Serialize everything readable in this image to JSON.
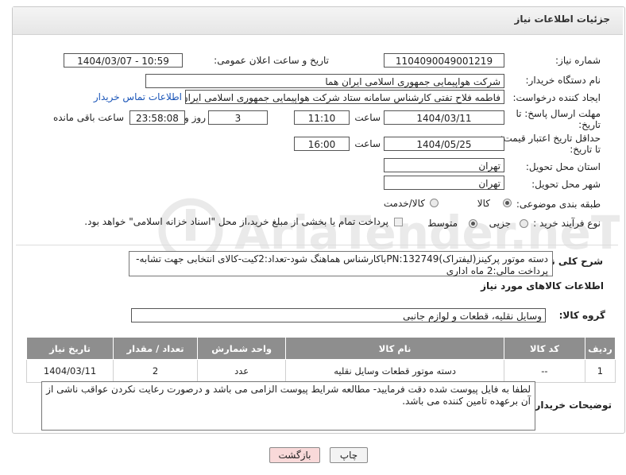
{
  "header": {
    "title": "جزئیات اطلاعات نیاز"
  },
  "fields": {
    "need_number_label": "شماره نیاز:",
    "need_number": "1104090049001219",
    "announce_label": "تاریخ و ساعت اعلان عمومی:",
    "announce_value": "1404/03/07 - 10:59",
    "buyer_org_label": "نام دستگاه خریدار:",
    "buyer_org": "شرکت هواپیمایی جمهوری اسلامی ایران هما",
    "requester_label": "ایجاد کننده درخواست:",
    "requester": "فاطمه فلاح تفتی کارشناس سامانه ستاد شرکت هواپیمایی جمهوری اسلامی ایران هما",
    "contact_link": "اطلاعات تماس خریدار",
    "deadline_label_1": "مهلت ارسال پاسخ: تا",
    "deadline_label_2": "تاریخ:",
    "deadline_date": "1404/03/11",
    "time_label": "ساعت",
    "deadline_time": "11:10",
    "days_value": "3",
    "days_label": "روز و",
    "remaining_value": "23:58:08",
    "remaining_label": "ساعت باقی مانده",
    "validity_label_1": "حداقل تاریخ اعتبار قیمت:",
    "validity_label_2": "تا تاریخ:",
    "validity_date": "1404/05/25",
    "validity_time_label": "ساعت",
    "validity_time": "16:00",
    "province_label": "استان محل تحویل:",
    "province": "تهران",
    "city_label": "شهر محل تحویل:",
    "city": "تهران",
    "category_label": "طبقه بندی موضوعی:",
    "category_options": [
      "کالا",
      "کالا/خدمت"
    ],
    "process_label": "نوع فرآیند خرید :",
    "process_options": [
      "جزیی",
      "متوسط"
    ],
    "payment_note": "پرداخت تمام یا بخشی از مبلغ خرید،از محل \"اسناد خزانه اسلامی\" خواهد بود."
  },
  "description": {
    "label": "شرح کلی نیاز:",
    "line1": "دسته موتور پرکینز(لیفتراک)PN:132749باکارشناس هماهنگ شود-تعداد:2کیت-کالای انتخابی جهت تشابه-",
    "line2": "پرداخت مالی:2 ماه اداری"
  },
  "goods": {
    "section_title": "اطلاعات کالاهای مورد نیاز",
    "group_label": "گروه کالا:",
    "group_value": "وسایل نقلیه، قطعات و لوازم جانبی",
    "columns": [
      "ردیف",
      "کد کالا",
      "نام کالا",
      "واحد شمارش",
      "تعداد / مقدار",
      "تاریخ نیاز"
    ],
    "rows": [
      {
        "row": "1",
        "code": "--",
        "name": "دسته موتور قطعات وسایل نقلیه",
        "unit": "عدد",
        "qty": "2",
        "date": "1404/03/11"
      }
    ]
  },
  "buyer_notes": {
    "label": "توضیحات خریدار:",
    "text": "لطفا به فایل پیوست شده دقت فرمایید- مطالعه شرایط پیوست الزامی می باشد و درصورت رعایت نکردن عواقب ناشی از آن برعهده تامین کننده می باشد."
  },
  "buttons": {
    "print": "چاپ",
    "back": "بازگشت"
  },
  "watermark_text": "AriaTender.neT",
  "colors": {
    "table_header": "#8e8e8e",
    "link": "#1a55b8",
    "back_button": "#f9d9d9"
  }
}
